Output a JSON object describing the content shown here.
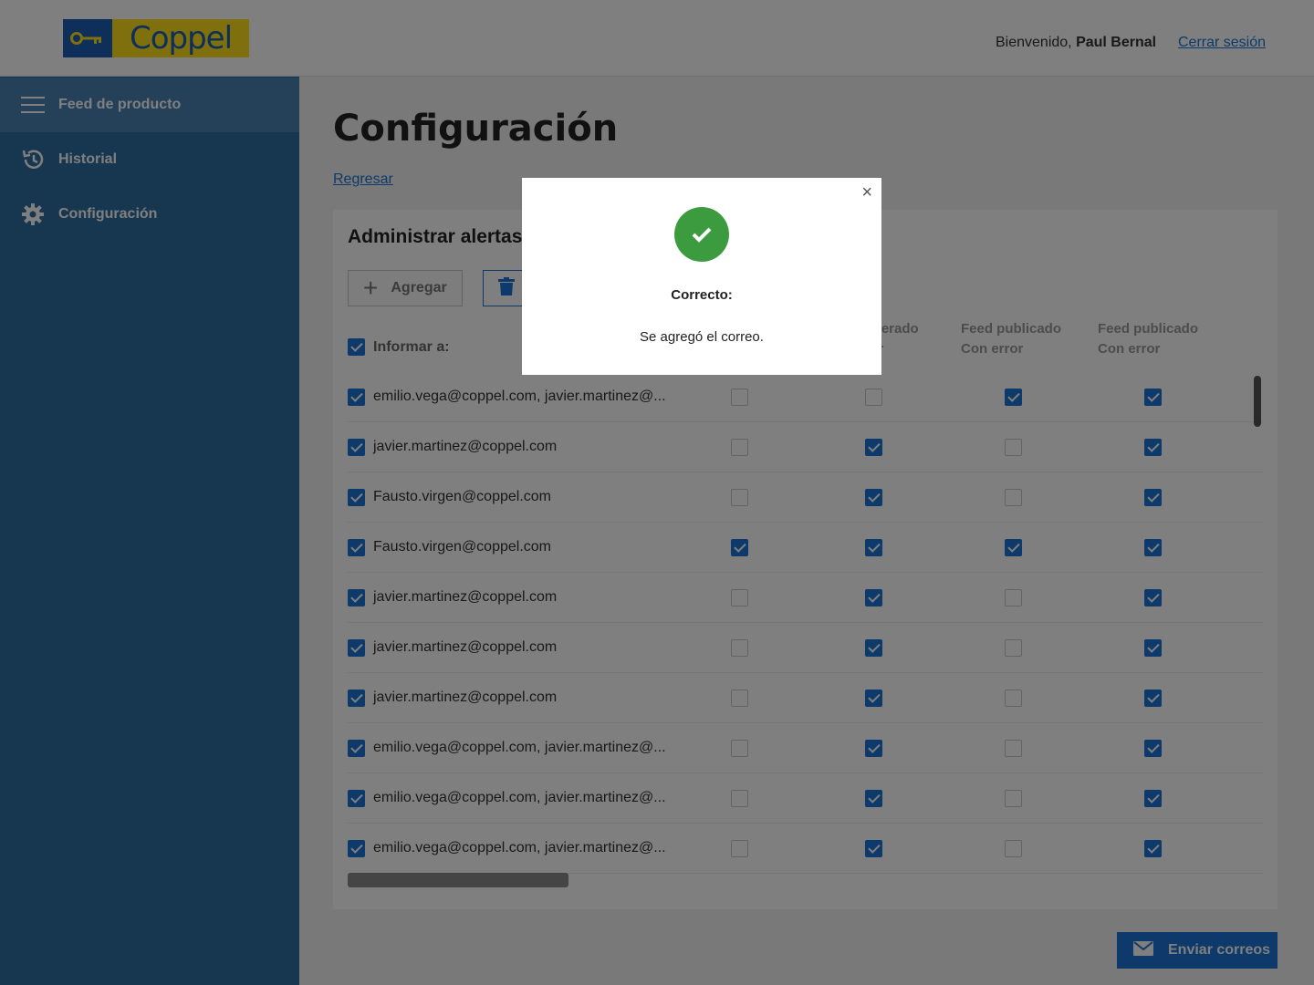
{
  "header": {
    "brand": "Coppel",
    "welcome_prefix": "Bienvenido, ",
    "user_name": "Paul Bernal",
    "logout": "Cerrar sesión"
  },
  "sidebar": {
    "items": [
      {
        "label": "Feed de producto",
        "icon": "menu-icon"
      },
      {
        "label": "Historial",
        "icon": "history-icon"
      },
      {
        "label": "Configuración",
        "icon": "gear-icon"
      }
    ]
  },
  "main": {
    "title": "Configuración",
    "back": "Regresar",
    "card_title": "Administrar alertas",
    "add_label": "Agregar",
    "inform_header": "Informar a:",
    "columns": [
      {
        "line1": "",
        "line2": ""
      },
      {
        "line1": "Feed generado",
        "line2": "Con error"
      },
      {
        "line1": "Feed publicado",
        "line2": "Con error"
      },
      {
        "line1": "Feed publicado",
        "line2": "Con error"
      }
    ],
    "rows": [
      {
        "email": "emilio.vega@coppel.com, javier.martinez@...",
        "checked": true,
        "c": [
          false,
          false,
          true,
          true
        ]
      },
      {
        "email": "javier.martinez@coppel.com",
        "checked": true,
        "c": [
          false,
          true,
          false,
          true
        ]
      },
      {
        "email": "Fausto.virgen@coppel.com",
        "checked": true,
        "c": [
          false,
          true,
          false,
          true
        ]
      },
      {
        "email": "Fausto.virgen@coppel.com",
        "checked": true,
        "c": [
          true,
          true,
          true,
          true
        ]
      },
      {
        "email": "javier.martinez@coppel.com",
        "checked": true,
        "c": [
          false,
          true,
          false,
          true
        ]
      },
      {
        "email": "javier.martinez@coppel.com",
        "checked": true,
        "c": [
          false,
          true,
          false,
          true
        ]
      },
      {
        "email": "javier.martinez@coppel.com",
        "checked": true,
        "c": [
          false,
          true,
          false,
          true
        ]
      },
      {
        "email": "emilio.vega@coppel.com, javier.martinez@...",
        "checked": true,
        "c": [
          false,
          true,
          false,
          true
        ]
      },
      {
        "email": "emilio.vega@coppel.com, javier.martinez@...",
        "checked": true,
        "c": [
          false,
          true,
          false,
          true
        ]
      },
      {
        "email": "emilio.vega@coppel.com, javier.martinez@...",
        "checked": true,
        "c": [
          false,
          true,
          false,
          true
        ]
      }
    ],
    "send_label": "Enviar correos"
  },
  "modal": {
    "title": "Correcto:",
    "message": "Se agregó el correo.",
    "close": "×"
  },
  "colors": {
    "primary": "#1a74d6",
    "sidebar": "#2f6ca0",
    "success": "#3c9b3f",
    "brand_yellow": "#ffe01b"
  }
}
